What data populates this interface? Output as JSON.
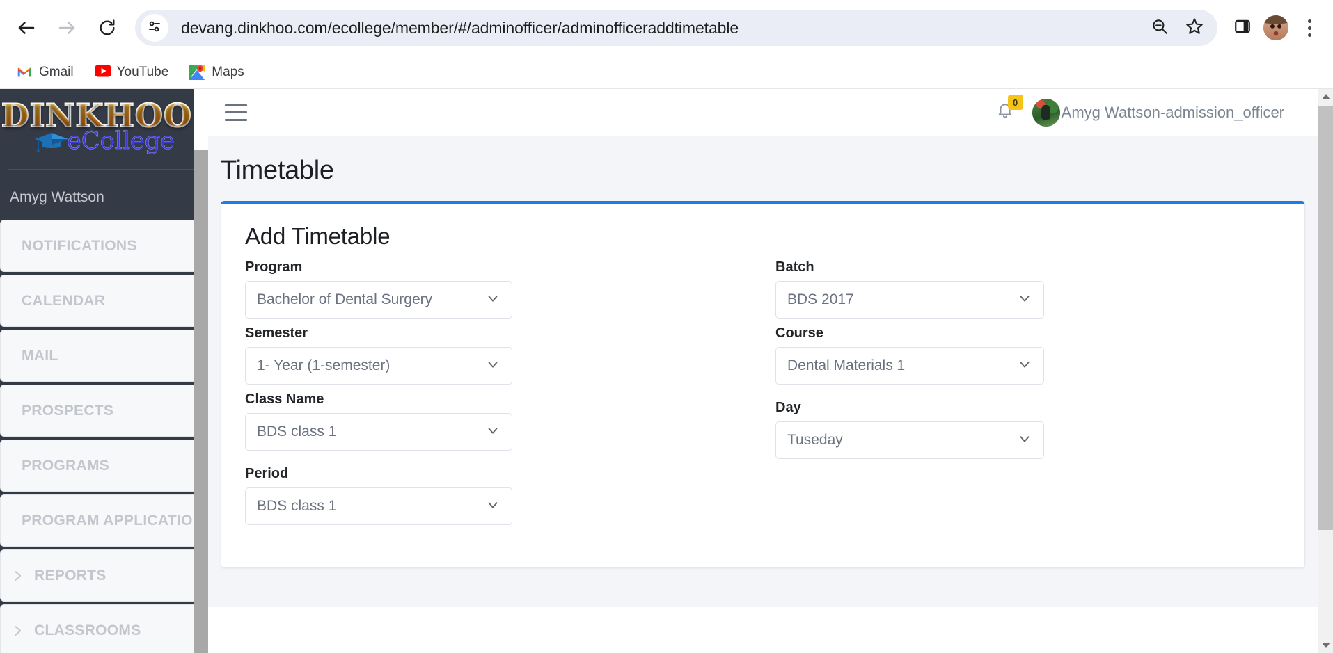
{
  "browser": {
    "back_label": "Back",
    "forward_label": "Forward",
    "reload_label": "Reload",
    "url": "devang.dinkhoo.com/ecollege/member/#/adminofficer/adminofficeraddtimetable",
    "site_info_label": "View site information",
    "zoom_out_label": "Zoom out",
    "bookmark_label": "Bookmark this tab",
    "side_panel_label": "Side panel",
    "profile_label": "Profile",
    "menu_label": "Customize and control Google Chrome",
    "bookmarks": [
      {
        "label": "Gmail",
        "icon": "gmail-icon"
      },
      {
        "label": "YouTube",
        "icon": "youtube-icon"
      },
      {
        "label": "Maps",
        "icon": "maps-icon"
      }
    ]
  },
  "sidebar": {
    "logo_main": "DINKHOO!",
    "logo_sub": "eCollege",
    "user_name": "Amyg Wattson",
    "items": [
      {
        "label": "NOTIFICATIONS",
        "expandable": false
      },
      {
        "label": "CALENDAR",
        "expandable": false
      },
      {
        "label": "MAIL",
        "expandable": false
      },
      {
        "label": "PROSPECTS",
        "expandable": false
      },
      {
        "label": "PROGRAMS",
        "expandable": false
      },
      {
        "label": "PROGRAM APPLICATIONS",
        "expandable": false
      },
      {
        "label": "REPORTS",
        "expandable": true
      },
      {
        "label": "CLASSROOMS",
        "expandable": true
      }
    ]
  },
  "appbar": {
    "menu_toggle_label": "Toggle navigation",
    "notifications_icon": "bell-icon",
    "notifications_count": "0",
    "user_label": "Amyg Wattson-admission_officer"
  },
  "page": {
    "title": "Timetable"
  },
  "card": {
    "title": "Add Timetable",
    "accent_color": "#1d7ce8",
    "fields_left": [
      {
        "label": "Program",
        "value": "Bachelor of Dental Surgery"
      },
      {
        "label": "Semester",
        "value": "1- Year (1-semester)"
      },
      {
        "label": "Class Name",
        "value": "BDS class 1"
      },
      {
        "label": "Period",
        "value": "BDS class 1"
      }
    ],
    "fields_right": [
      {
        "label": "Batch",
        "value": "BDS 2017"
      },
      {
        "label": "Course",
        "value": "Dental Materials 1"
      },
      {
        "label": "Day",
        "value": "Tuseday"
      }
    ]
  },
  "colors": {
    "sidebar_bg": "#343a46",
    "page_bg": "#f4f5f9",
    "accent": "#1d7ce8",
    "badge": "#f6c317"
  }
}
